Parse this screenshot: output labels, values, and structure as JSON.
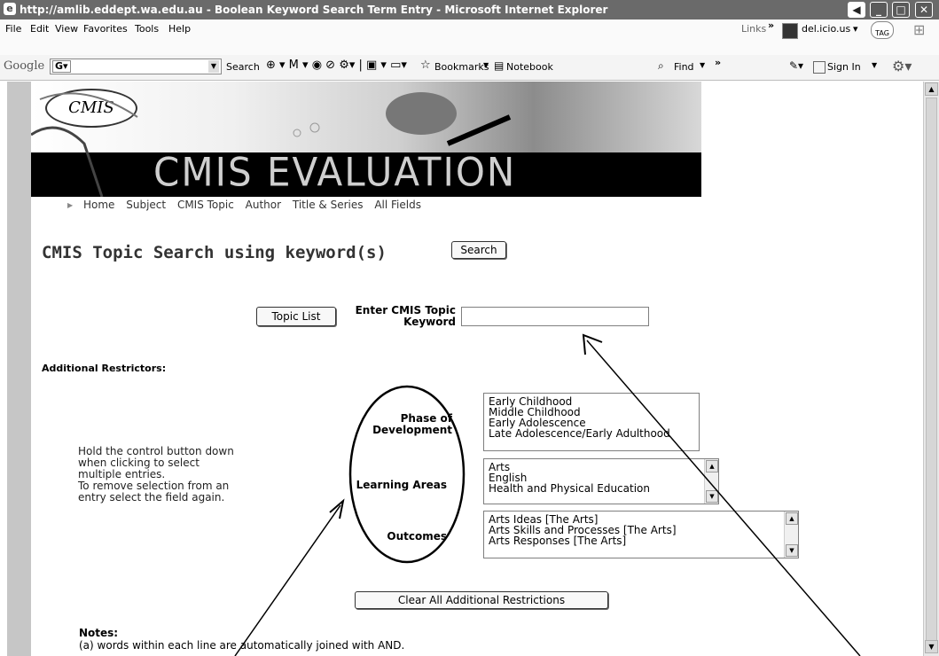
{
  "window": {
    "title": "http://amlib.eddept.wa.edu.au - Boolean Keyword Search Term Entry - Microsoft Internet Explorer"
  },
  "menubar": {
    "items": [
      "File",
      "Edit",
      "View",
      "Favorites",
      "Tools",
      "Help"
    ],
    "links_label": "Links",
    "links_chevron": "»",
    "delicious_label": "del.icio.us",
    "tag_label": "TAG"
  },
  "toolbar": {
    "google_label": "Google",
    "search_label": "Search",
    "bookmarks_label": "Bookmarks",
    "notebook_label": "Notebook",
    "find_label": "Find",
    "more_chevron": "»",
    "signin_label": "Sign In"
  },
  "banner": {
    "logo_text": "CMIS",
    "title": "CMIS EVALUATION"
  },
  "nav": {
    "items": [
      "Home",
      "Subject",
      "CMIS Topic",
      "Author",
      "Title & Series",
      "All Fields"
    ]
  },
  "page": {
    "heading": "CMIS Topic Search using keyword(s)",
    "search_button": "Search",
    "topic_list_button": "Topic List",
    "keyword_label_line1": "Enter CMIS Topic",
    "keyword_label_line2": "Keyword",
    "keyword_value": "",
    "additional_restrictors": "Additional Restrictors:",
    "instructions": [
      "Hold the control button down",
      "when clicking to select",
      "multiple entries.",
      "To remove selection from an",
      "entry select the field again."
    ],
    "phase_label_line1": "Phase of",
    "phase_label_line2": "Development",
    "phase_options": [
      "Early Childhood",
      "Middle Childhood",
      "Early Adolescence",
      "Late Adolescence/Early Adulthood"
    ],
    "learning_label": "Learning Areas",
    "learning_options": [
      "Arts",
      "English",
      "Health and Physical Education"
    ],
    "outcomes_label": "Outcomes",
    "outcomes_options": [
      "Arts Ideas [The Arts]",
      "Arts Skills and Processes [The Arts]",
      "Arts Responses [The Arts]"
    ],
    "clear_button": "Clear All Additional Restrictions",
    "notes_heading": "Notes:",
    "notes_line": "(a) words within each line are automatically joined with AND."
  }
}
